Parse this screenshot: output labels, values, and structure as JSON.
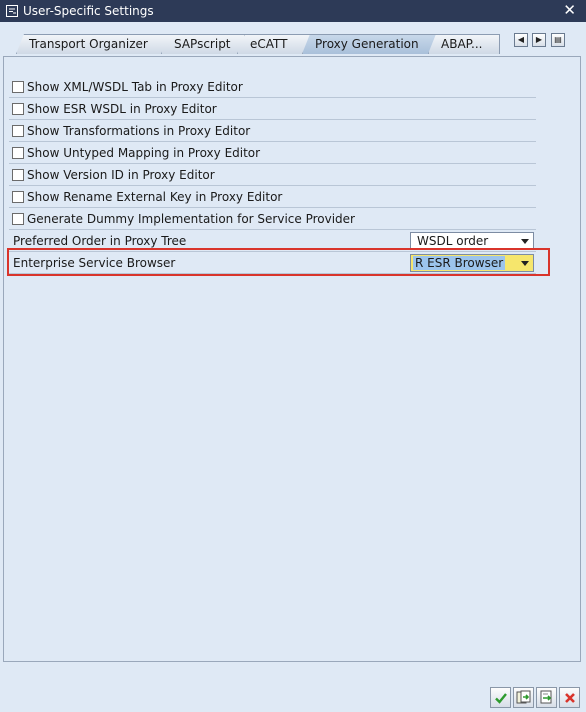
{
  "window": {
    "title": "User-Specific Settings",
    "icon": "window-settings-icon",
    "close_icon": "close-icon"
  },
  "tabs": [
    {
      "label": "Transport Organizer",
      "active": false
    },
    {
      "label": "SAPscript",
      "active": false
    },
    {
      "label": "eCATT",
      "active": false
    },
    {
      "label": "Proxy Generation",
      "active": true
    },
    {
      "label": "ABAP..."
    }
  ],
  "tab_nav": {
    "left_icon": "triangle-left-icon",
    "right_icon": "triangle-right-icon",
    "list_icon": "tab-list-icon"
  },
  "checkboxes": [
    {
      "label": "Show XML/WSDL Tab in Proxy Editor",
      "checked": false
    },
    {
      "label": "Show ESR WSDL in Proxy Editor",
      "checked": false
    },
    {
      "label": "Show Transformations in Proxy Editor",
      "checked": false
    },
    {
      "label": "Show Untyped Mapping in Proxy Editor",
      "checked": false
    },
    {
      "label": "Show Version ID in Proxy Editor",
      "checked": false
    },
    {
      "label": "Show Rename External Key in Proxy Editor",
      "checked": false
    },
    {
      "label": "Generate Dummy Implementation for Service Provider",
      "checked": false
    }
  ],
  "fields": [
    {
      "label": "Preferred Order in Proxy Tree",
      "value": "WSDL order"
    },
    {
      "label": "Enterprise Service Browser",
      "value": "R ESR Browser",
      "highlighted": true
    }
  ],
  "colors": {
    "highlight_frame": "#d9342b",
    "titlebar": "#2d3a57",
    "panel": "#dfe9f5",
    "focused_dropdown": "#f6e66c"
  },
  "toolbar": [
    {
      "icon": "green-check-icon"
    },
    {
      "icon": "copy-save-icon"
    },
    {
      "icon": "transfer-save-icon"
    },
    {
      "icon": "cancel-x-icon"
    }
  ]
}
